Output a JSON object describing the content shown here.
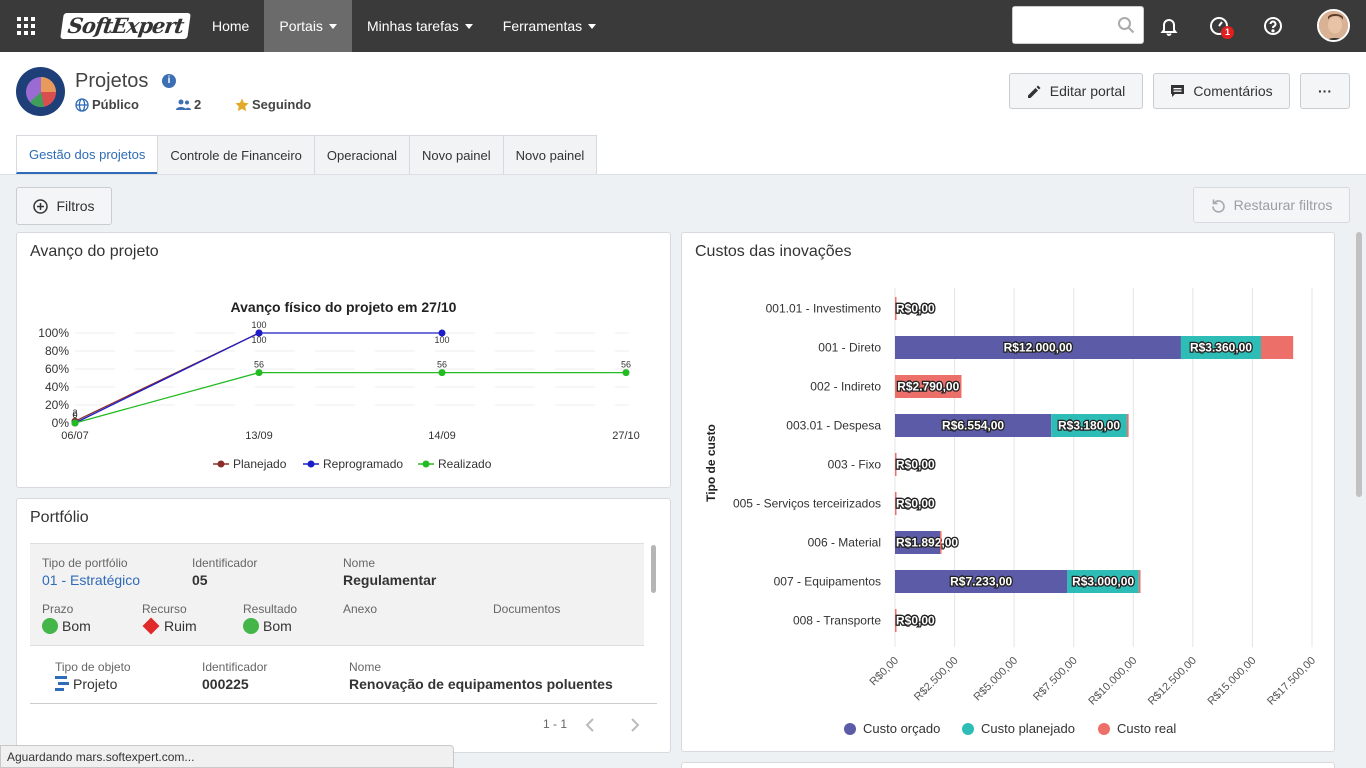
{
  "topbar": {
    "logo": "SoftExpert",
    "nav": [
      {
        "label": "Home",
        "caret": false,
        "active": false
      },
      {
        "label": "Portais",
        "caret": true,
        "active": true
      },
      {
        "label": "Minhas tarefas",
        "caret": true,
        "active": false
      },
      {
        "label": "Ferramentas",
        "caret": true,
        "active": false
      }
    ],
    "search_placeholder": "",
    "notification_count": "1"
  },
  "header": {
    "title": "Projetos",
    "visibility": "Público",
    "members": "2",
    "following": "Seguindo",
    "buttons": {
      "edit": "Editar portal",
      "comments": "Comentários",
      "more": "···"
    }
  },
  "tabs": [
    "Gestão dos projetos",
    "Controle de Financeiro",
    "Operacional",
    "Novo painel",
    "Novo painel"
  ],
  "filters": {
    "filter_label": "Filtros",
    "restore_label": "Restaurar filtros"
  },
  "progress_widget": {
    "title": "Avanço do projeto"
  },
  "costs_widget": {
    "title": "Custos das inovações"
  },
  "portfolio": {
    "title": "Portfólio",
    "header_labels": {
      "type": "Tipo de portfólio",
      "identifier": "Identificador",
      "name": "Nome",
      "deadline": "Prazo",
      "resource": "Recurso",
      "result": "Resultado",
      "attachment": "Anexo",
      "documents": "Documentos"
    },
    "portfolio_type": "01 - Estratégico",
    "portfolio_id": "05",
    "portfolio_name": "Regulamentar",
    "deadline": "Bom",
    "resource": "Ruim",
    "result": "Bom",
    "object_labels": {
      "type": "Tipo de objeto",
      "identifier": "Identificador",
      "name": "Nome"
    },
    "object_type": "Projeto",
    "object_id": "000225",
    "object_name": "Renovação de equipamentos poluentes",
    "pager": "1 - 1"
  },
  "status_bar": "Aguardando mars.softexpert.com...",
  "chart_data": [
    {
      "type": "line",
      "title": "Avanço físico do projeto em 27/10",
      "x": [
        "06/07",
        "13/09",
        "14/09",
        "27/10"
      ],
      "ylim": [
        0,
        100
      ],
      "yticks": [
        "0%",
        "20%",
        "40%",
        "60%",
        "80%",
        "100%"
      ],
      "series": [
        {
          "name": "Planejado",
          "color": "#8b2d2d",
          "values": [
            2,
            100,
            null,
            null
          ],
          "labels": [
            "2",
            "100",
            null,
            null
          ]
        },
        {
          "name": "Reprogramado",
          "color": "#1c1cc8",
          "values": [
            0,
            100,
            100,
            null
          ],
          "labels": [
            "0",
            "100",
            "100",
            null
          ]
        },
        {
          "name": "Realizado",
          "color": "#22bb22",
          "values": [
            0,
            56,
            56,
            56
          ],
          "labels": [
            "0",
            "56",
            "56",
            "56"
          ]
        }
      ],
      "legend": "bottom"
    },
    {
      "type": "bar",
      "orientation": "horizontal",
      "stacked": true,
      "ylabel": "Tipo de custo",
      "categories": [
        "001.01 - Investimento",
        "001 - Direto",
        "002 - Indireto",
        "003.01 - Despesa",
        "003 - Fixo",
        "005 - Serviços terceirizados",
        "006 - Material",
        "007 - Equipamentos",
        "008 - Transporte"
      ],
      "xlim": [
        0,
        17500
      ],
      "xticks": [
        "R$0,00",
        "R$2.500,00",
        "R$5.000,00",
        "R$7.500,00",
        "R$10.000,00",
        "R$12.500,00",
        "R$15.000,00",
        "R$17.500,00"
      ],
      "series": [
        {
          "name": "Custo orçado",
          "color": "#5b5ba8",
          "values": [
            0,
            12000,
            0,
            6554,
            0,
            0,
            1892,
            7233,
            0
          ],
          "labels": [
            "R$0,00",
            "R$12.000,00",
            "",
            "R$6.554,00",
            "R$0,00",
            "R$0,00",
            "R$1.892,00",
            "R$7.233,00",
            "R$0,00"
          ]
        },
        {
          "name": "Custo planejado",
          "color": "#2dbdb6",
          "values": [
            0,
            3360,
            0,
            3180,
            0,
            0,
            0,
            3000,
            0
          ],
          "labels": [
            "",
            "R$3.360,00",
            "",
            "R$3.180,00",
            "",
            "",
            "",
            "R$3.000,00",
            ""
          ]
        },
        {
          "name": "Custo real",
          "color": "#ec6f6a",
          "values": [
            0,
            1350,
            2790,
            70,
            0,
            0,
            60,
            70,
            0
          ],
          "labels": [
            "R$0,00",
            "",
            "R$2.790,00",
            "",
            "R$0,00",
            "R$0,00",
            "",
            "",
            "R$0,00"
          ]
        }
      ],
      "legend": "bottom"
    }
  ]
}
